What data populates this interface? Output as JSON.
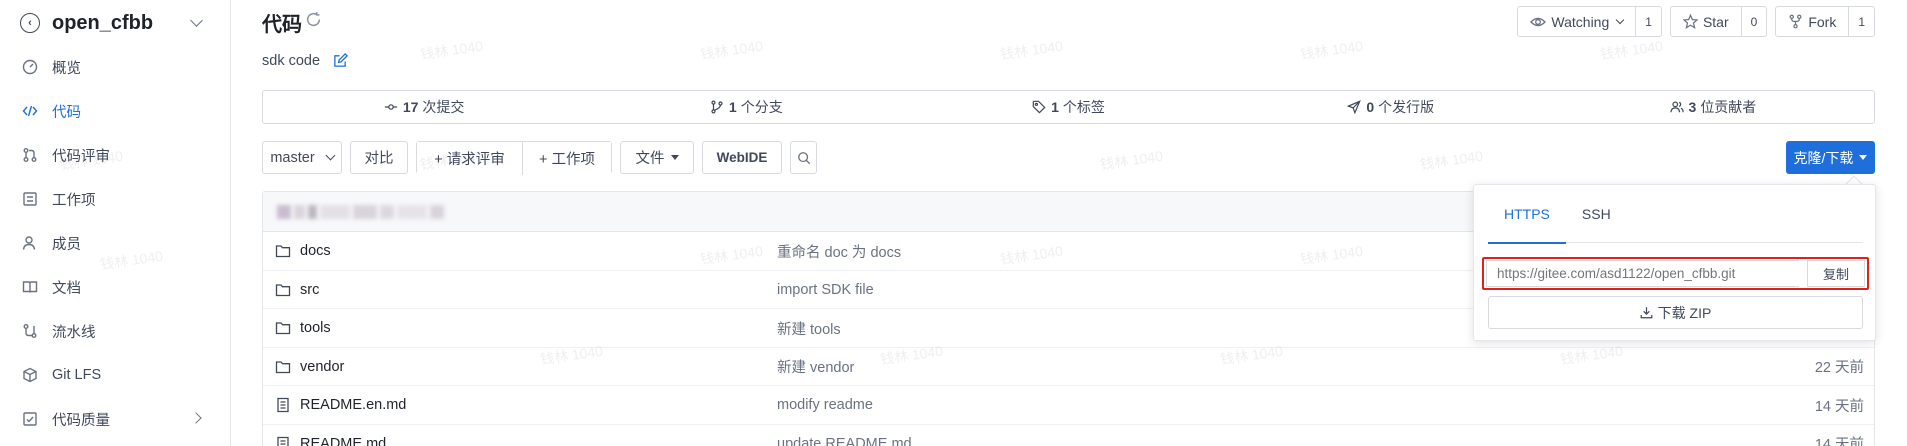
{
  "sidebar": {
    "repo_name": "open_cfbb",
    "items": [
      {
        "label": "概览",
        "icon": "dashboard-icon"
      },
      {
        "label": "代码",
        "icon": "code-icon",
        "active": true
      },
      {
        "label": "代码评审",
        "icon": "pull-request-icon"
      },
      {
        "label": "工作项",
        "icon": "issues-icon"
      },
      {
        "label": "成员",
        "icon": "members-icon"
      },
      {
        "label": "文档",
        "icon": "book-icon"
      },
      {
        "label": "流水线",
        "icon": "pipeline-icon"
      },
      {
        "label": "Git LFS",
        "icon": "package-icon"
      },
      {
        "label": "代码质量",
        "icon": "quality-icon"
      }
    ]
  },
  "header": {
    "title": "代码",
    "description": "sdk code",
    "watch": {
      "label": "Watching",
      "count": "1"
    },
    "star": {
      "label": "Star",
      "count": "0"
    },
    "fork": {
      "label": "Fork",
      "count": "1"
    }
  },
  "stats": {
    "commits": {
      "num": "17",
      "label": "次提交"
    },
    "branches": {
      "num": "1",
      "label": "个分支"
    },
    "tags": {
      "num": "1",
      "label": "个标签"
    },
    "releases": {
      "num": "0",
      "label": "个发行版"
    },
    "contributors": {
      "num": "3",
      "label": "位贡献者"
    }
  },
  "toolbar": {
    "branch": "master",
    "compare": "对比",
    "new_review": "+ 请求评审",
    "new_issue": "+ 工作项",
    "file": "文件",
    "webide": "WebIDE",
    "clone": "克隆/下载"
  },
  "files": [
    {
      "name": "docs",
      "type": "folder",
      "message": "重命名 doc 为 docs",
      "time": ""
    },
    {
      "name": "src",
      "type": "folder",
      "message": "import SDK file",
      "time": ""
    },
    {
      "name": "tools",
      "type": "folder",
      "message": "新建 tools",
      "time": ""
    },
    {
      "name": "vendor",
      "type": "folder",
      "message": "新建 vendor",
      "time": "22 天前"
    },
    {
      "name": "README.en.md",
      "type": "file",
      "message": "modify readme",
      "time": "14 天前"
    },
    {
      "name": "README.md",
      "type": "file",
      "message": "update README.md.",
      "time": "14 天前"
    }
  ],
  "clone_popover": {
    "tab_https": "HTTPS",
    "tab_ssh": "SSH",
    "url_placeholder": "https://gitee.com/asd1122/open_cfbb.git",
    "copy": "复制",
    "download_zip": "下载 ZIP"
  },
  "watermark": "钱林 1040",
  "colors": {
    "accent": "#1e6fdb",
    "highlight_border": "#e0211a"
  }
}
